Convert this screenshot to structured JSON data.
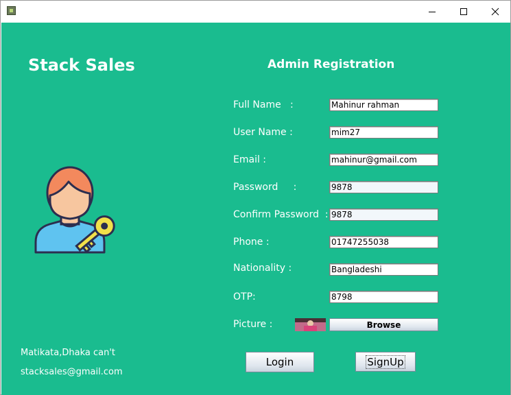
{
  "window": {
    "title": ""
  },
  "brand": {
    "name": "Stack Sales"
  },
  "form": {
    "heading": "Admin Registration",
    "fields": [
      {
        "label": "Full Name   :",
        "value": "Mahinur rahman"
      },
      {
        "label": "User Name :",
        "value": "mim27"
      },
      {
        "label": "Email :",
        "value": "mahinur@gmail.com"
      },
      {
        "label": "Password     :",
        "value": "9878"
      },
      {
        "label": "Confirm Password  :",
        "value": "9878"
      },
      {
        "label": "Phone :",
        "value": "01747255038"
      },
      {
        "label": "Nationality :",
        "value": "Bangladeshi"
      },
      {
        "label": "OTP:",
        "value": "8798"
      }
    ],
    "picture_label": "Picture :",
    "browse_label": "Browse",
    "login_label": "Login",
    "signup_label": "SignUp"
  },
  "footer": {
    "address": "Matikata,Dhaka can't",
    "email": "stacksales@gmail.com"
  },
  "colors": {
    "background": "#1abc8f",
    "text": "#ffffff"
  },
  "icons": {
    "app": "app-icon",
    "illustration": "admin-with-key-icon"
  }
}
